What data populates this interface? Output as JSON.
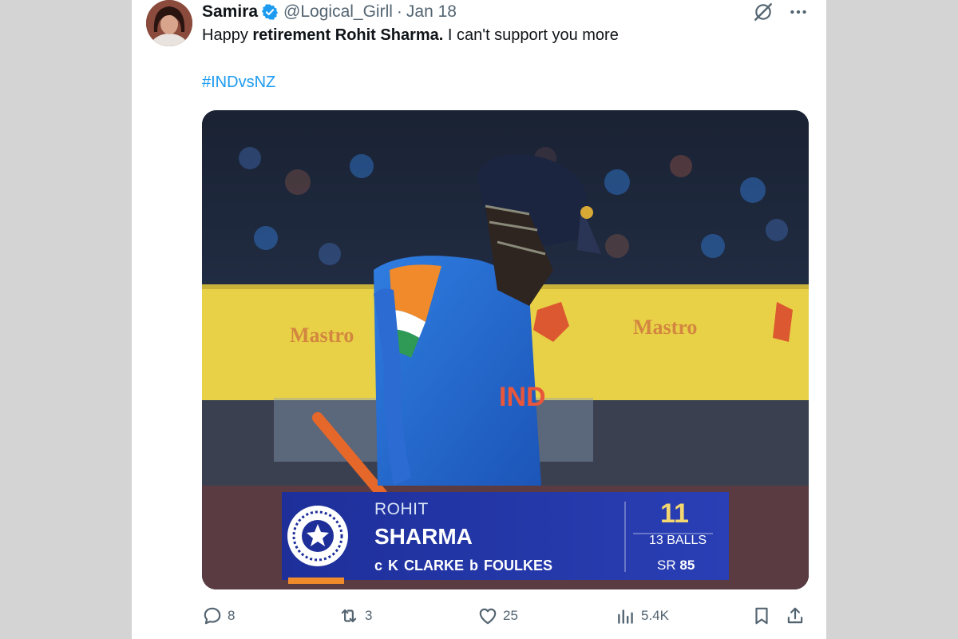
{
  "tweet": {
    "author_name": "Samira",
    "handle": "@Logical_Girll",
    "separator": "·",
    "date": "Jan 18",
    "text_before": "Happy ",
    "text_bold": "retirement Rohit Sharma.",
    "text_after": " I can't support you more",
    "hashtag": "#INDvsNZ"
  },
  "media": {
    "score_graphic": {
      "first_name": "ROHIT",
      "last_name": "SHARMA",
      "dismissal": "c K CLARKE  b FOULKES",
      "runs": "11",
      "balls": "13 BALLS",
      "sr_label": "SR",
      "strike_rate": "85"
    },
    "banner_text": "Mastro",
    "jersey_text": "IND"
  },
  "actions": {
    "replies": "8",
    "retweets": "3",
    "likes": "25",
    "views": "5.4K"
  },
  "colors": {
    "link_blue": "#1d9bf0",
    "text_primary": "#0f1419",
    "text_secondary": "#536471",
    "verified_blue": "#1d9bf0"
  }
}
